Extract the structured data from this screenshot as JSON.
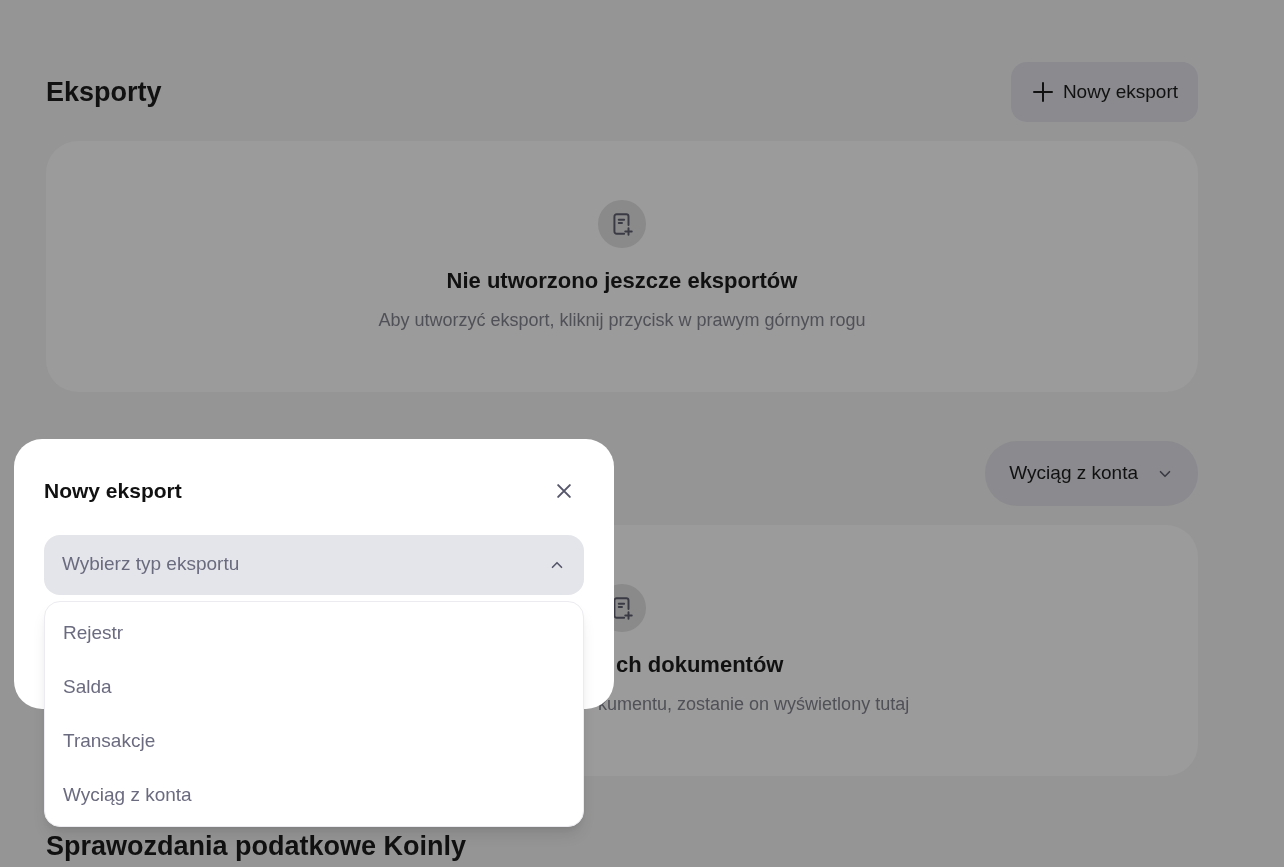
{
  "exports": {
    "title": "Eksporty",
    "button": {
      "label": "Nowy eksport"
    },
    "empty": {
      "title": "Nie utworzono jeszcze eksportów",
      "subtitle": "Aby utworzyć eksport, kliknij przycisk w prawym górnym rogu"
    }
  },
  "documents": {
    "filter": {
      "label": "Wyciąg z konta"
    },
    "empty": {
      "title": "ch dokumentów",
      "subtitle": "kumentu, zostanie on wyświetlony tutaj"
    }
  },
  "tax_reports": {
    "title": "Sprawozdania podatkowe Koinly"
  },
  "modal": {
    "title": "Nowy eksport",
    "select": {
      "placeholder": "Wybierz typ eksportu",
      "expanded": true,
      "options": [
        {
          "label": "Rejestr"
        },
        {
          "label": "Salda"
        },
        {
          "label": "Transakcje"
        },
        {
          "label": "Wyciąg z konta"
        }
      ]
    }
  }
}
